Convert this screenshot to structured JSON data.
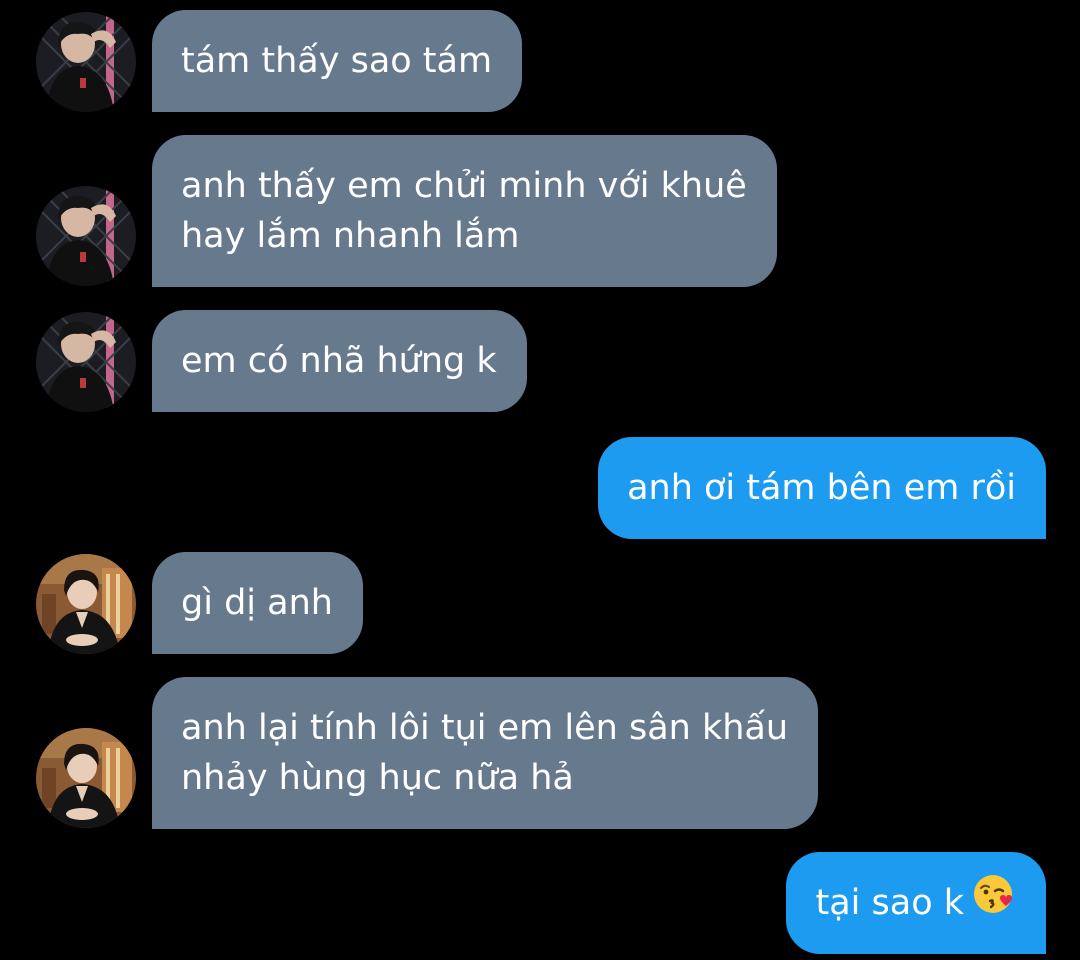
{
  "colors": {
    "background": "#000000",
    "incoming_bubble": "#677a8d",
    "outgoing_bubble": "#1d9bf0",
    "text": "#ffffff"
  },
  "messages": [
    {
      "direction": "incoming",
      "sender_avatar": "photo-avatar-1",
      "lines": [
        "tám thấy sao tám"
      ]
    },
    {
      "direction": "incoming",
      "sender_avatar": "photo-avatar-1",
      "lines": [
        "anh thấy em chửi minh với khuê",
        "hay lắm nhanh lắm"
      ]
    },
    {
      "direction": "incoming",
      "sender_avatar": "photo-avatar-1",
      "lines": [
        "em có nhã hứng k"
      ]
    },
    {
      "direction": "outgoing",
      "lines": [
        "anh ơi tám bên em rồi"
      ]
    },
    {
      "direction": "incoming",
      "sender_avatar": "photo-avatar-2",
      "lines": [
        "gì dị anh"
      ]
    },
    {
      "direction": "incoming",
      "sender_avatar": "photo-avatar-2",
      "lines": [
        "anh lại tính lôi tụi em lên sân khấu",
        "nhảy hùng hục nữa hả"
      ]
    },
    {
      "direction": "outgoing",
      "lines": [
        "tại sao k"
      ],
      "emoji": "kissing-face-emoji"
    }
  ]
}
